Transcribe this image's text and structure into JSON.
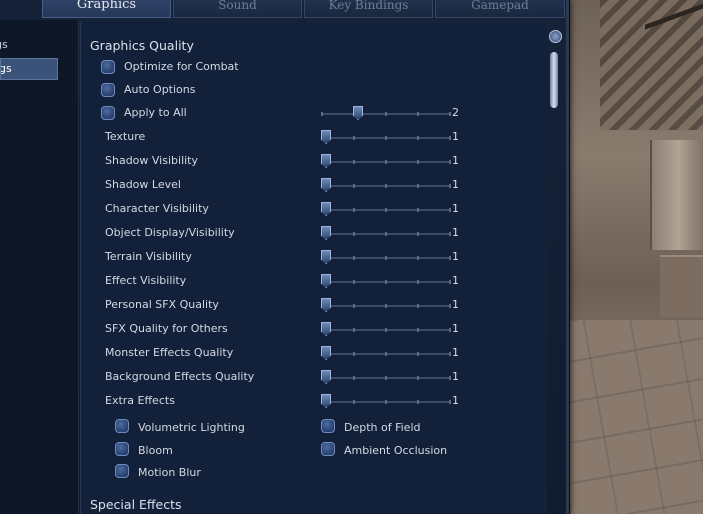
{
  "tabs": [
    "Graphics",
    "Sound",
    "Key Bindings",
    "Gamepad"
  ],
  "active_tab": "Graphics",
  "left_nav": [
    "ngs",
    "ings"
  ],
  "graphics_quality": {
    "title": "Graphics Quality",
    "checkboxes": [
      "Optimize for Combat",
      "Auto Options",
      "Apply to All"
    ],
    "apply_to_all_value": "2",
    "apply_to_all_level": 0.25,
    "settings": [
      {
        "label": "Texture",
        "value": "1"
      },
      {
        "label": "Shadow Visibility",
        "value": "1"
      },
      {
        "label": "Shadow Level",
        "value": "1"
      },
      {
        "label": "Character Visibility",
        "value": "1"
      },
      {
        "label": "Object Display/Visibility",
        "value": "1"
      },
      {
        "label": "Terrain Visibility",
        "value": "1"
      },
      {
        "label": "Effect Visibility",
        "value": "1"
      },
      {
        "label": "Personal SFX Quality",
        "value": "1"
      },
      {
        "label": "SFX Quality for Others",
        "value": "1"
      },
      {
        "label": "Monster Effects Quality",
        "value": "1"
      },
      {
        "label": "Background Effects Quality",
        "value": "1"
      },
      {
        "label": "Extra Effects",
        "value": "1"
      }
    ],
    "extra_effects": [
      "Volumetric Lighting",
      "Depth of Field",
      "Bloom",
      "Ambient Occlusion",
      "Motion Blur"
    ]
  },
  "special_effects_title": "Special Effects",
  "colors": {
    "panel": "#13203a",
    "accent": "#4e6da3",
    "text": "#d4d9e3"
  }
}
